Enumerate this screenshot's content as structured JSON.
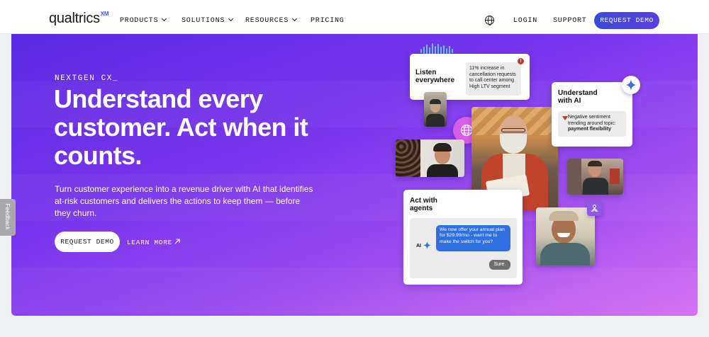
{
  "nav": {
    "logo_text": "qualtrics",
    "logo_sup": "XM",
    "items": [
      "PRODUCTS",
      "SOLUTIONS",
      "RESOURCES",
      "PRICING"
    ],
    "login": "LOGIN",
    "support": "SUPPORT",
    "request_demo": "REQUEST DEMO"
  },
  "hero": {
    "eyebrow": "NEXTGEN CX_",
    "headline": "Understand every customer. Act when it counts.",
    "subtext": "Turn customer experience into a revenue driver with AI that identifies at-risk customers and delivers the actions to keep them — before they churn.",
    "cta_primary": "REQUEST DEMO",
    "cta_secondary": "LEARN MORE"
  },
  "cards": {
    "listen": {
      "title_line1": "Listen",
      "title_line2": "everywhere",
      "insight": "11% increase in cancellation requests to call center among High LTV segment"
    },
    "ai": {
      "title_line1": "Understand",
      "title_line2": "with AI",
      "insight": "Negative sentiment trending around topic:",
      "topic": "payment flexibility"
    },
    "act": {
      "title_line1": "Act with",
      "title_line2": "agents",
      "ai_label": "AI",
      "message": "We now offer your annual plan for $29.99/mo - want me to make the switch for you?",
      "reply": "Sure."
    }
  },
  "feedback_tab": "Feedback",
  "colors": {
    "accent": "#3f3fd6",
    "hero_start": "#5a2be3",
    "hero_end": "#d56ef4",
    "chat_bubble": "#2f6fe0"
  }
}
